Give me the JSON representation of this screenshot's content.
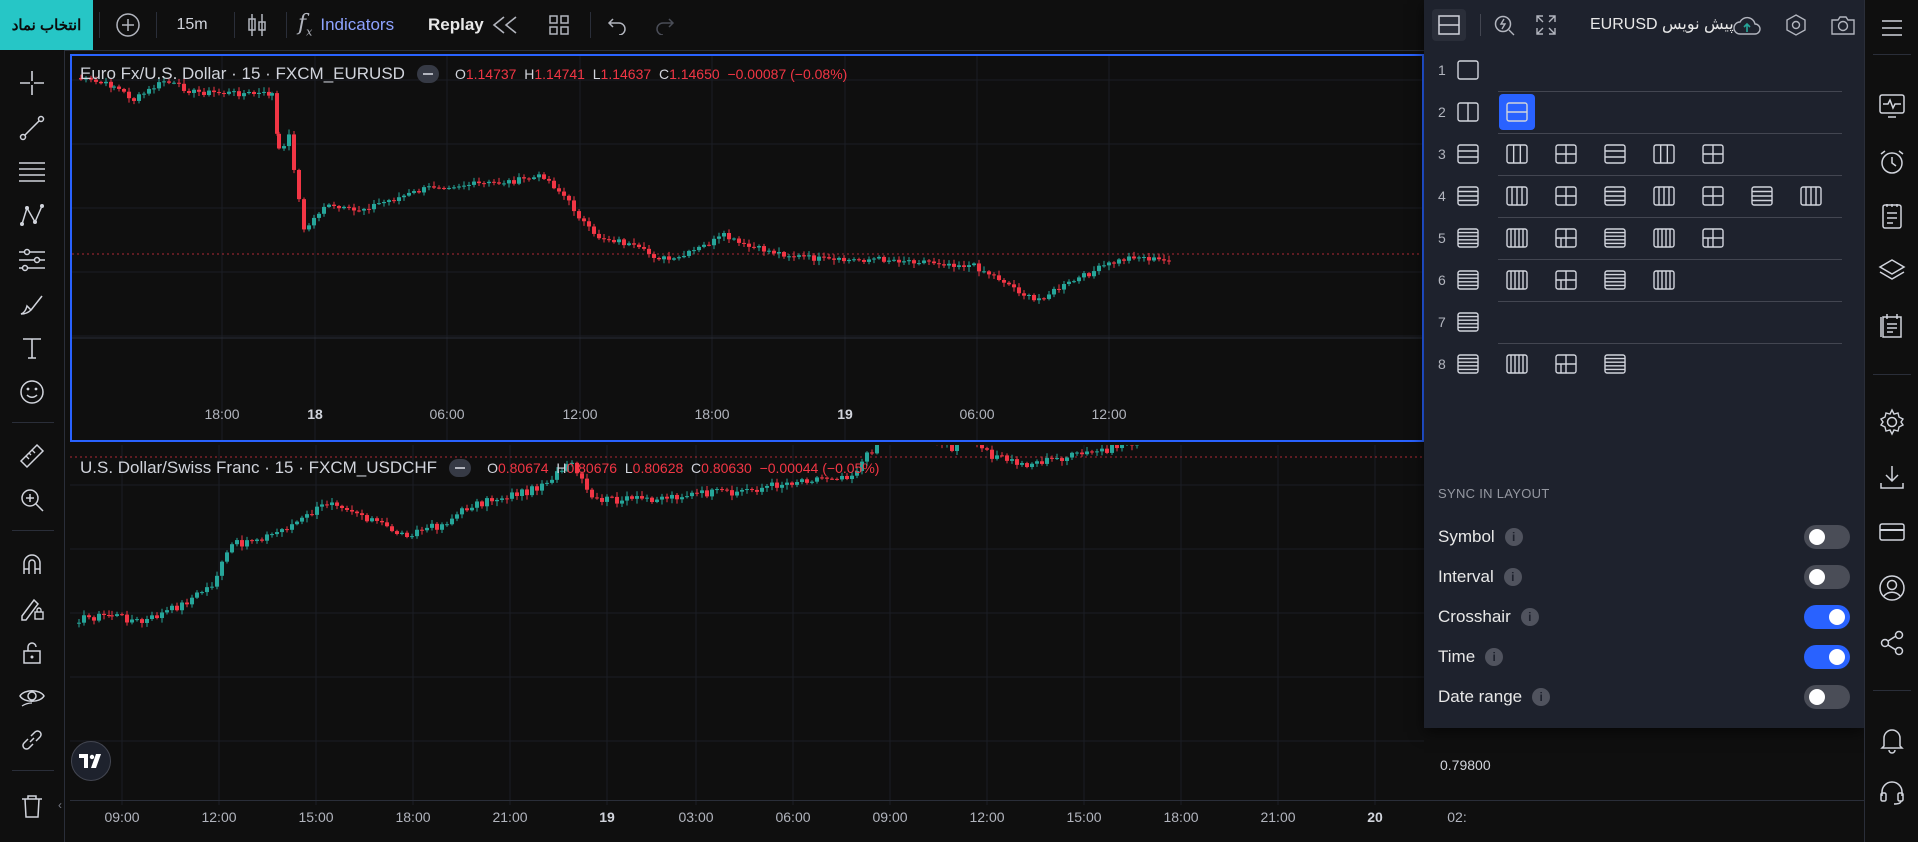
{
  "topbar": {
    "symbol_button": "انتخاب نماد",
    "interval": "15m",
    "indicators_label": "Indicators",
    "replay_label": "Replay",
    "layout_name": "EURUSD پیش نویس"
  },
  "charts": [
    {
      "title": "Euro Fx/U.S. Dollar · 15 · FXCM_EURUSD",
      "open_label": "O",
      "open": "1.14737",
      "high_label": "H",
      "high": "1.14741",
      "low_label": "L",
      "low": "1.14637",
      "close_label": "C",
      "close": "1.14650",
      "change": "−0.00087 (−0.08%)",
      "time_labels": [
        "18:00",
        "18",
        "06:00",
        "12:00",
        "18:00",
        "19",
        "06:00",
        "12:00"
      ]
    },
    {
      "title": "U.S. Dollar/Swiss Franc · 15 · FXCM_USDCHF",
      "open_label": "O",
      "open": "0.80674",
      "high_label": "H",
      "high": "0.80676",
      "low_label": "L",
      "low": "0.80628",
      "close_label": "C",
      "close": "0.80630",
      "change": "−0.00044 (−0.05%)",
      "price_label": "0.79800",
      "time_labels": [
        "09:00",
        "12:00",
        "15:00",
        "18:00",
        "21:00",
        "19",
        "03:00",
        "06:00",
        "09:00",
        "12:00",
        "15:00",
        "18:00",
        "21:00",
        "20",
        "02:"
      ]
    }
  ],
  "layout_panel": {
    "rows": [
      {
        "num": "1",
        "count": 1,
        "active_index": -1
      },
      {
        "num": "2",
        "count": 2,
        "active_index": 1
      },
      {
        "num": "3",
        "count": 6,
        "active_index": -1
      },
      {
        "num": "4",
        "count": 8,
        "active_index": -1
      },
      {
        "num": "5",
        "count": 6,
        "active_index": -1
      },
      {
        "num": "6",
        "count": 5,
        "active_index": -1
      },
      {
        "num": "7",
        "count": 1,
        "active_index": -1
      },
      {
        "num": "8",
        "count": 4,
        "active_index": -1
      }
    ],
    "sync_heading": "SYNC IN LAYOUT",
    "sync_options": [
      {
        "label": "Symbol",
        "on": false
      },
      {
        "label": "Interval",
        "on": false
      },
      {
        "label": "Crosshair",
        "on": true
      },
      {
        "label": "Time",
        "on": true
      },
      {
        "label": "Date range",
        "on": false
      }
    ]
  },
  "colors": {
    "accent": "#2962ff",
    "up": "#26a69a",
    "down": "#f23645",
    "symbol_button": "#26c6c6",
    "panel": "#1e222d"
  },
  "icons": {
    "left_toolbar": [
      "crosshair-icon",
      "trend-line-icon",
      "fib-retracement-icon",
      "pattern-icon",
      "forecast-icon",
      "brush-icon",
      "text-icon",
      "emoji-icon",
      "ruler-icon",
      "zoom-in-icon",
      "magnet-icon",
      "lock-drawing-icon",
      "lock-icon",
      "eye-icon",
      "link-icon",
      "trash-icon"
    ],
    "right_toolbar": [
      "hamburger-icon",
      "pulse-icon",
      "alarm-icon",
      "notes-icon",
      "layers-icon",
      "calendar-icon",
      "gear-icon",
      "download-icon",
      "card-icon",
      "user-icon",
      "share-icon",
      "bell-icon",
      "headset-icon"
    ]
  }
}
